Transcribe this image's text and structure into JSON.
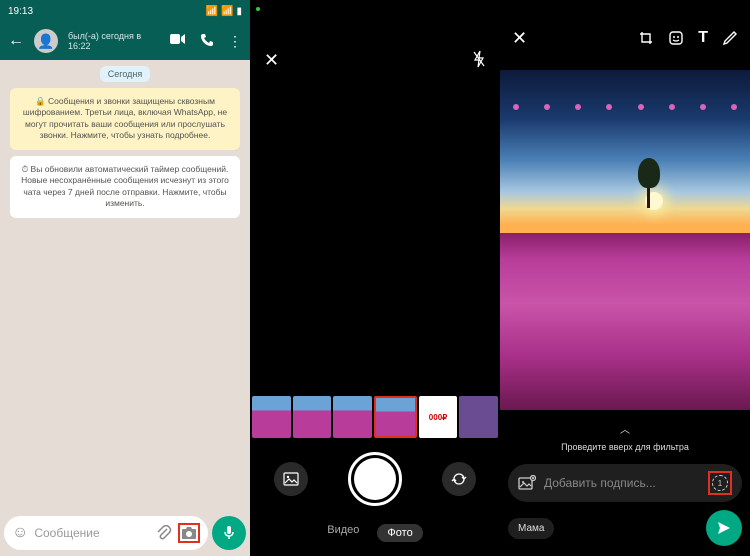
{
  "p1": {
    "time": "19:13",
    "contact_status": "был(-а) сегодня в 16:22",
    "date_label": "Сегодня",
    "encryption_notice": "🔒 Сообщения и звонки защищены сквозным шифрованием. Третьи лица, включая WhatsApp, не могут прочитать ваши сообщения или прослушать звонки. Нажмите, чтобы узнать подробнее.",
    "timer_notice": "⏱ Вы обновили автоматический таймер сообщений. Новые несохранённые сообщения исчезнут из этого чата через 7 дней после отправки. Нажмите, чтобы изменить.",
    "input_placeholder": "Сообщение"
  },
  "p2": {
    "mode_video": "Видео",
    "mode_photo": "Фото"
  },
  "p3": {
    "swipe_hint": "Проведите вверх для фильтра",
    "caption_placeholder": "Добавить подпись...",
    "recipient": "Мама"
  }
}
